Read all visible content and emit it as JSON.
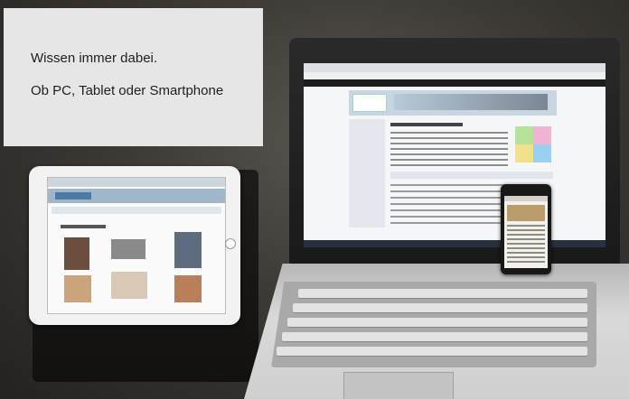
{
  "caption": {
    "line1": "Wissen immer dabei.",
    "line2": "Ob PC, Tablet oder Smartphone"
  },
  "devices": [
    "tablet",
    "laptop",
    "smartphone"
  ],
  "colors": {
    "caption_box": "#e6e6e6",
    "background_dark": "#24221f",
    "website_accent": "#3f6ea6"
  }
}
